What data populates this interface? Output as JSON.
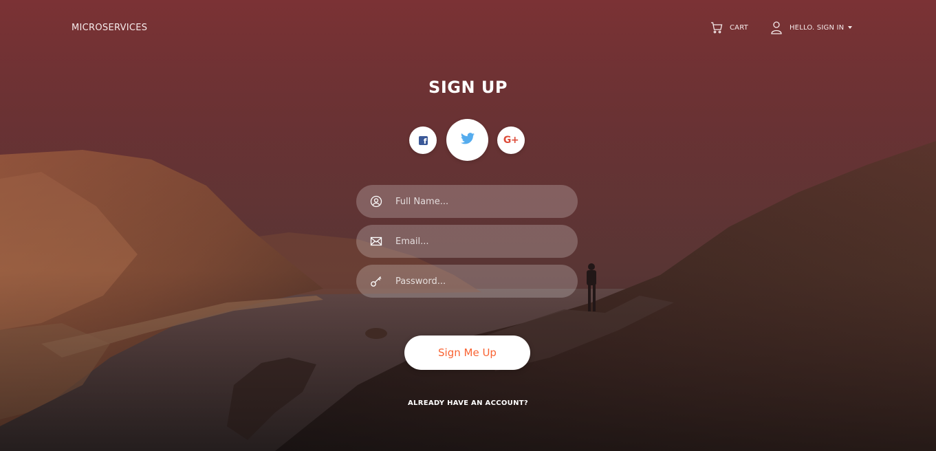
{
  "nav": {
    "brand": "MICROSERVICES",
    "cart_label": "CART",
    "account_label": "HELLO. SIGN IN"
  },
  "form": {
    "title": "SIGN UP",
    "social": [
      {
        "icon": "facebook-icon",
        "color": "#3b5998"
      },
      {
        "icon": "twitter-icon",
        "color": "#55acee"
      },
      {
        "icon": "google-plus-icon",
        "color": "#dd4b39"
      }
    ],
    "full_name_placeholder": "Full Name...",
    "email_placeholder": "Email...",
    "password_placeholder": "Password...",
    "submit_label": "Sign Me Up",
    "login_link": "ALREADY HAVE AN ACCOUNT?"
  },
  "colors": {
    "accent": "#f96332",
    "overlay_top": "#7c3236",
    "overlay_bottom": "#1a1413"
  }
}
